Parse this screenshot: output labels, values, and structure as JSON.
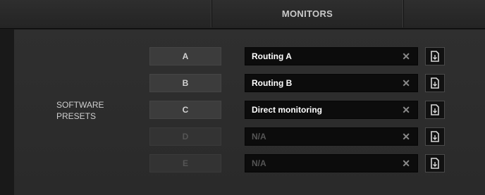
{
  "tabs": {
    "left": "",
    "monitors": "MONITORS",
    "right": ""
  },
  "section": {
    "label_line1": "SOFTWARE",
    "label_line2": "PRESETS"
  },
  "presets": [
    {
      "slot": "A",
      "name": "Routing A",
      "enabled": true
    },
    {
      "slot": "B",
      "name": "Routing B",
      "enabled": true
    },
    {
      "slot": "C",
      "name": "Direct monitoring",
      "enabled": true
    },
    {
      "slot": "D",
      "name": "N/A",
      "enabled": false
    },
    {
      "slot": "E",
      "name": "N/A",
      "enabled": false
    }
  ],
  "icons": {
    "clear": "close-icon",
    "save": "save-preset-icon"
  },
  "colors": {
    "background": "#191919",
    "panel": "#2d2d2d",
    "field": "#0c0c0c",
    "text": "#ffffff",
    "disabled_text": "#555555"
  }
}
